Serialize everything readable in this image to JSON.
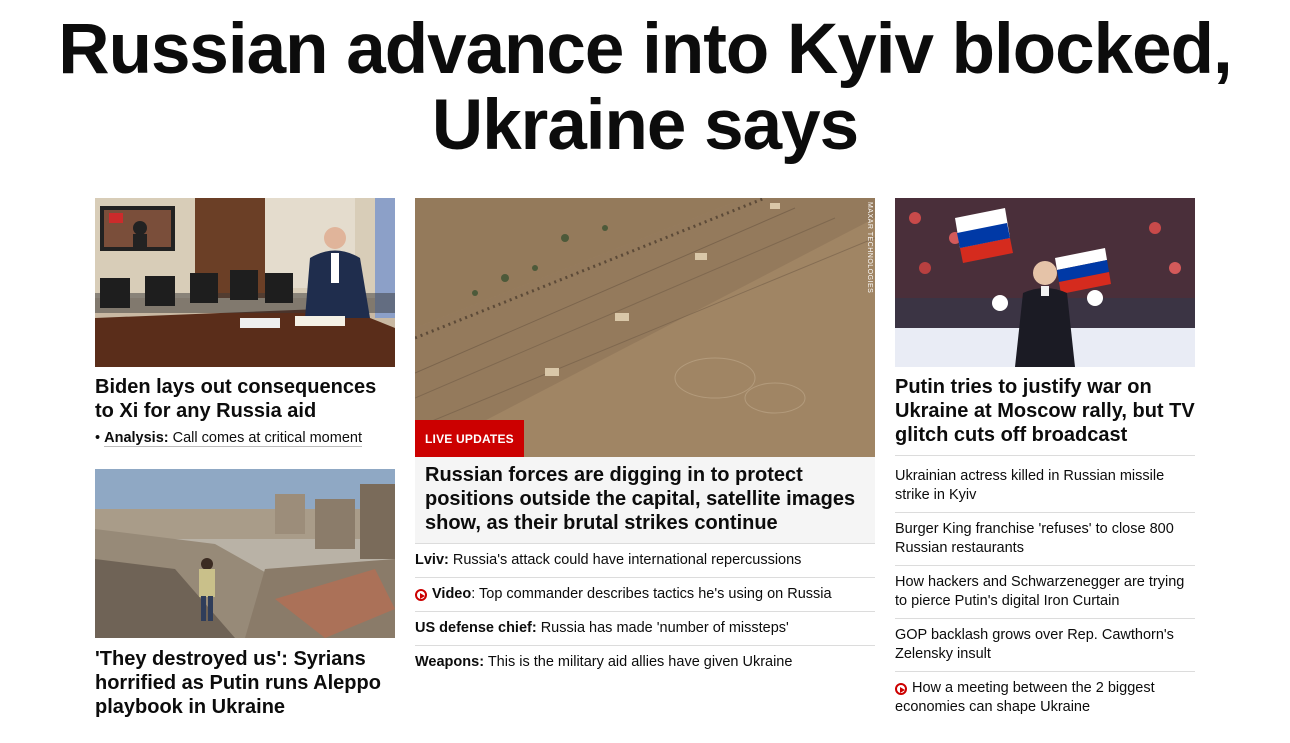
{
  "headline": "Russian advance into Kyiv blocked, Ukraine says",
  "left": {
    "story1": {
      "title": "Biden lays out consequences to Xi for any Russia aid",
      "sub_bullet": "•",
      "sub_label": "Analysis:",
      "sub_text": "Call comes at critical moment"
    },
    "story2": {
      "title": "'They destroyed us': Syrians horrified as Putin runs Aleppo playbook in Ukraine"
    }
  },
  "middle": {
    "badge": "LIVE UPDATES",
    "image_credit": "MAXAR TECHNOLOGIES",
    "title": "Russian forces are digging in to protect positions outside the capital, satellite images show, as their brutal strikes continue",
    "items": [
      {
        "label": "Lviv:",
        "text": "Russia's attack could have international repercussions",
        "video": false
      },
      {
        "label": "Video",
        "text": ": Top commander describes tactics he's using on Russia",
        "video": true
      },
      {
        "label": "US defense chief:",
        "text": "Russia has made 'number of missteps'",
        "video": false
      },
      {
        "label": "Weapons:",
        "text": "This is the military aid allies have given Ukraine",
        "video": false
      }
    ]
  },
  "right": {
    "title": "Putin tries to justify war on Ukraine at Moscow rally, but TV glitch cuts off broadcast",
    "items": [
      {
        "text": "Ukrainian actress killed in Russian missile strike in Kyiv",
        "video": false
      },
      {
        "text": "Burger King franchise 'refuses' to close 800 Russian restaurants",
        "video": false
      },
      {
        "text": "How hackers and Schwarzenegger are trying to pierce Putin's digital Iron Curtain",
        "video": false
      },
      {
        "text": "GOP backlash grows over Rep. Cawthorn's Zelensky insult",
        "video": false
      },
      {
        "text": "How a meeting between the 2 biggest economies can shape Ukraine",
        "video": true
      }
    ]
  },
  "colors": {
    "accent_red": "#cc0000",
    "text": "#0c0c0c",
    "divider": "#dcdcdc"
  },
  "icons": [
    "play-video-icon"
  ]
}
